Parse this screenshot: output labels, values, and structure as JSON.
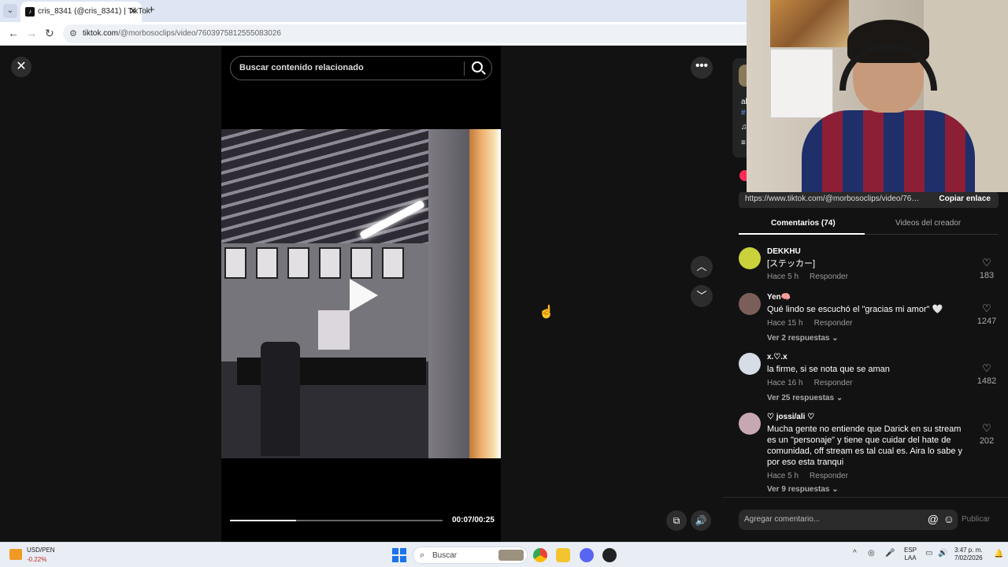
{
  "browser": {
    "tab_title": "cris_8341 (@cris_8341) | TikTok",
    "tab_close": "✕",
    "new_tab": "+",
    "back": "←",
    "forward": "→",
    "reload": "↻",
    "url_host": "tiktok.com",
    "url_path": "/@morbosoclips/video/7603975812555083026"
  },
  "player": {
    "close": "✕",
    "search_placeholder": "Buscar contenido relacionado",
    "progress_fraction": 0.31,
    "time": "00:07/00:25",
    "more": "•••",
    "up": "︿",
    "down": "﹀"
  },
  "panel": {
    "author_frag_1": "al",
    "author_frag_2": "#",
    "author_frag_3": "♫",
    "author_frag_4": "≡",
    "share_url": "https://www.tiktok.com/@morbosoclips/video/760...",
    "copy_link": "Copiar enlace",
    "tab_comments": "Comentarios (74)",
    "tab_creator": "Videos del creador",
    "comment_placeholder": "Agregar comentario...",
    "post": "Publicar"
  },
  "comments": [
    {
      "user": "DEKKHU",
      "text": "[ステッカー]",
      "time": "Hace 5 h",
      "reply": "Responder",
      "likes": "183",
      "replies": ""
    },
    {
      "user": "Yen🧠",
      "text": "Qué lindo se escuchó el \"gracias mi amor\" 🤍",
      "time": "Hace 15 h",
      "reply": "Responder",
      "likes": "1247",
      "replies": "Ver 2 respuestas ⌄"
    },
    {
      "user": "x.♡.x",
      "text": "la firme, si se nota que se aman",
      "time": "Hace 16 h",
      "reply": "Responder",
      "likes": "1482",
      "replies": "Ver 25 respuestas ⌄"
    },
    {
      "user": "♡ jossi/ali ♡",
      "text": "Mucha gente no entiende que Darick en su stream es un \"personaje\" y tiene que cuidar del hate de comunidad, off stream es tal cual es. Aira lo sabe y por eso esta tranqui",
      "time": "Hace 5 h",
      "reply": "Responder",
      "likes": "202",
      "replies": "Ver 9 respuestas ⌄"
    }
  ],
  "taskbar": {
    "stock_name": "USD/PEN",
    "stock_change": "-0.22%",
    "search_text": "Buscar",
    "lang_1": "ESP",
    "lang_2": "LAA",
    "time": "3:47 p. m.",
    "date": "7/02/2026"
  },
  "colors": {
    "accent": "#fe2c55",
    "background": "#121212"
  }
}
